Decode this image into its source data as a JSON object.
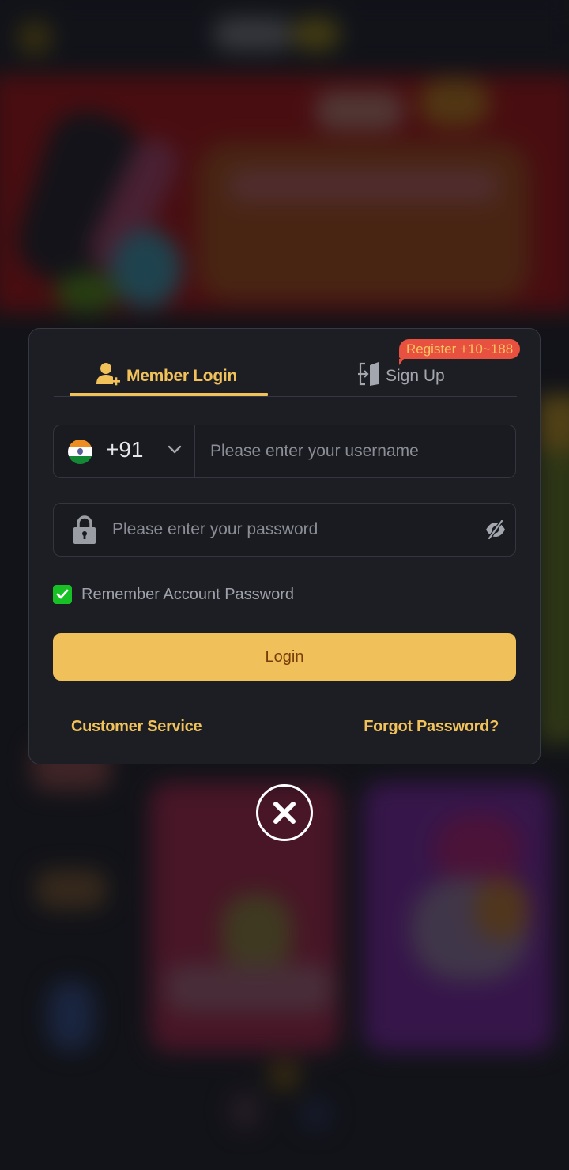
{
  "dialog": {
    "tabs": [
      {
        "label": "Member Login",
        "icon": "user-plus-icon",
        "active": true
      },
      {
        "label": "Sign Up",
        "icon": "door-enter-icon",
        "active": false
      }
    ],
    "signup_badge": "Register +10~188",
    "username": {
      "country_flag": "india-flag-icon",
      "country_code": "+91",
      "value": "",
      "placeholder": "Please enter your username"
    },
    "password": {
      "value": "",
      "placeholder": "Please enter your password",
      "visibility": "hidden"
    },
    "remember": {
      "label": "Remember Account Password",
      "checked": true
    },
    "login_button": "Login",
    "links": {
      "customer_service": "Customer Service",
      "forgot_password": "Forgot Password?"
    }
  },
  "close_button": {
    "icon": "close-icon"
  },
  "colors": {
    "accent": "#f2c25a",
    "badge": "#e8513f",
    "checkbox": "#16c025",
    "dialog_bg": "#1d1e23",
    "button_text": "#7a3c07"
  }
}
